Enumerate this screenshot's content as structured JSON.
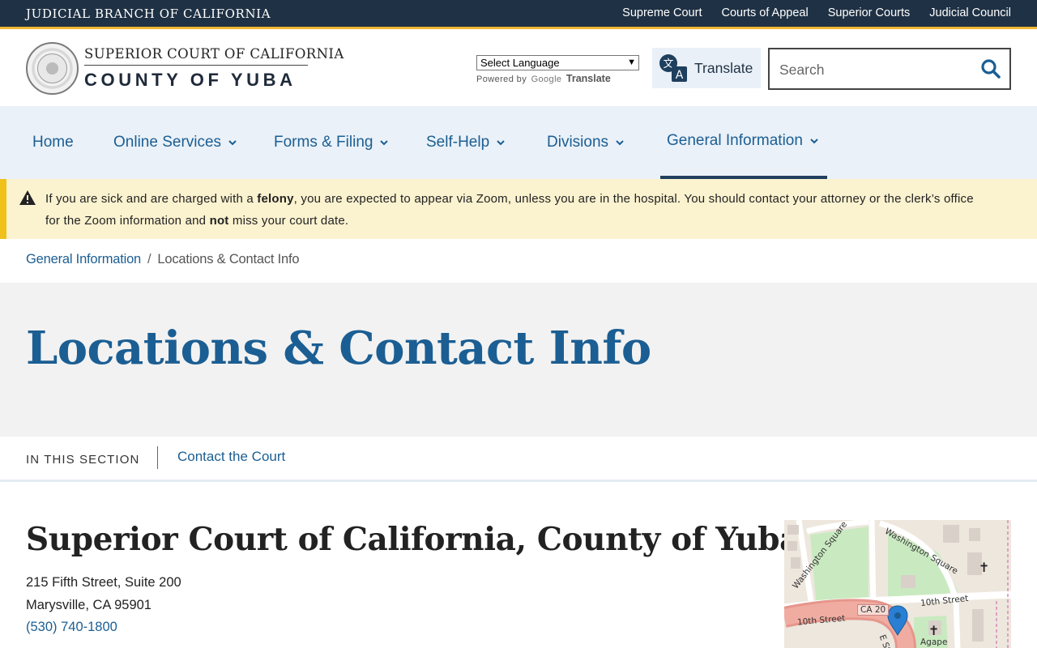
{
  "utility": {
    "brand": "JUDICIAL BRANCH OF CALIFORNIA",
    "links": [
      "Supreme Court",
      "Courts of Appeal",
      "Superior Courts",
      "Judicial Council"
    ]
  },
  "header": {
    "logo_line1": "SUPERIOR COURT OF CALIFORNIA",
    "logo_line2": "COUNTY OF YUBA",
    "language_select": "Select Language",
    "powered_by": "Powered by",
    "google": "Google",
    "google_translate": "Translate",
    "translate_label": "Translate",
    "search_placeholder": "Search"
  },
  "nav": {
    "items": [
      "Home",
      "Online Services",
      "Forms & Filing",
      "Self-Help",
      "Divisions",
      "General Information"
    ],
    "active": "General Information"
  },
  "alert": {
    "part1": "If you are sick and are charged with a ",
    "bold1": "felony",
    "part2": ", you are expected to appear via Zoom, unless you are in the hospital.  You should contact your attorney or the clerk’s office for the Zoom information and ",
    "bold2": "not",
    "part3": " miss your court date."
  },
  "breadcrumb": {
    "parent": "General Information",
    "separator": "/",
    "current": "Locations & Contact Info"
  },
  "page": {
    "title": "Locations & Contact Info"
  },
  "section": {
    "label": "IN THIS SECTION",
    "link": "Contact the Court"
  },
  "court": {
    "name": "Superior Court of California, County of Yuba",
    "address1": "215 Fifth Street, Suite 200",
    "address2": "Marysville, CA 95901",
    "phone": "(530) 740-1800"
  },
  "map": {
    "labels": [
      "Washington Square",
      "Washington Square",
      "10th Street",
      "10th Street",
      "CA 20",
      "Agape",
      "E St"
    ]
  },
  "colors": {
    "utility_bg": "#1f3144",
    "accent_gold": "#f2b731",
    "link_blue": "#1b5e93",
    "nav_bg": "#eaf1f8",
    "alert_bg": "#fbf2cf",
    "alert_border": "#f0c11b"
  }
}
